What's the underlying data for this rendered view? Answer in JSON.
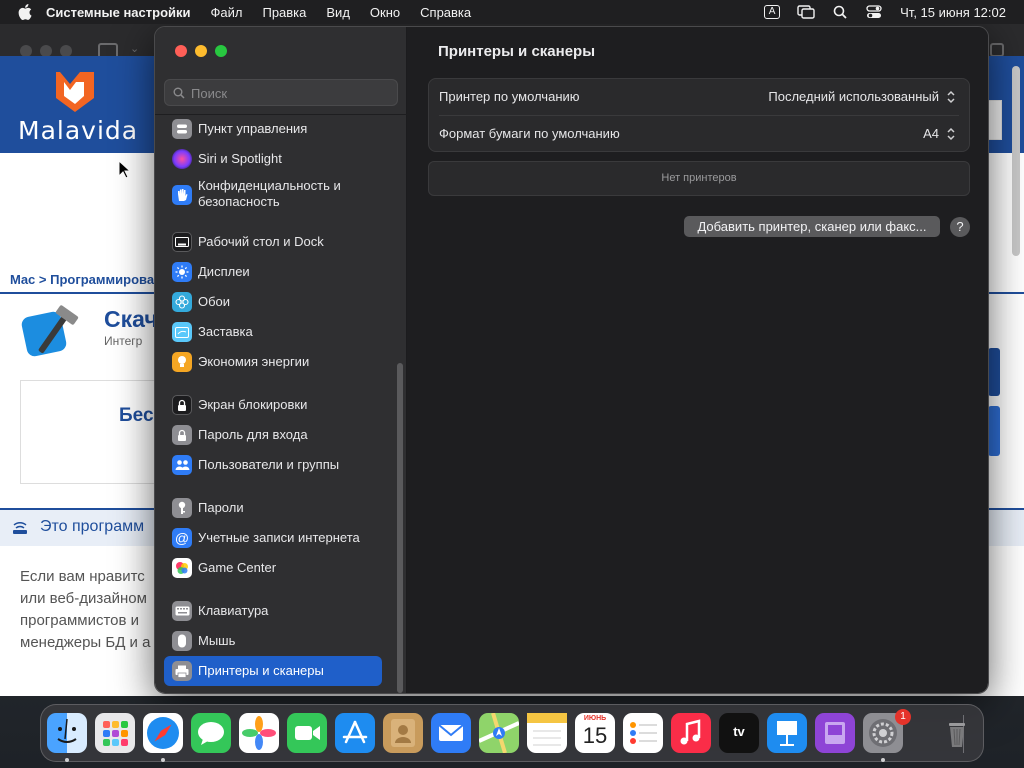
{
  "menubar": {
    "app_name": "Системные настройки",
    "items": [
      "Файл",
      "Правка",
      "Вид",
      "Окно",
      "Справка"
    ],
    "input_indicator": "A",
    "clock": "Чт, 15 июня  12:02"
  },
  "browser": {
    "site_logo": "Malavida",
    "breadcrumb": "Mac > Программирова",
    "app_title": "Скач",
    "app_subtitle": "Интегр",
    "download_text": "Бес",
    "section_title": "Это программ",
    "paragraph_lines": [
      "Если вам нравитс",
      "или веб-дизайном",
      "программистов и",
      "менеджеры БД и а"
    ]
  },
  "settings": {
    "search_placeholder": "Поиск",
    "sidebar": {
      "items": [
        {
          "label": "Пункт управления",
          "icon": "control-center-icon",
          "color": "#8e8e93"
        },
        {
          "label": "Siri и Spotlight",
          "icon": "siri-icon",
          "color": "#b14ad6"
        },
        {
          "label": "Конфиденциальность и",
          "label2": "безопасность",
          "icon": "privacy-hand-icon",
          "color": "#2f7cf6"
        },
        {
          "label": "Рабочий стол и Dock",
          "icon": "desktop-dock-icon",
          "color": "#1c1c1e"
        },
        {
          "label": "Дисплеи",
          "icon": "displays-sun-icon",
          "color": "#2f7cf6"
        },
        {
          "label": "Обои",
          "icon": "wallpaper-flower-icon",
          "color": "#34aadc"
        },
        {
          "label": "Заставка",
          "icon": "screensaver-icon",
          "color": "#5ac8fa"
        },
        {
          "label": "Экономия энергии",
          "icon": "energy-bulb-icon",
          "color": "#f5a623"
        },
        {
          "label": "Экран блокировки",
          "icon": "lock-screen-icon",
          "color": "#1c1c1e"
        },
        {
          "label": "Пароль для входа",
          "icon": "login-password-lock-icon",
          "color": "#8e8e93"
        },
        {
          "label": "Пользователи и группы",
          "icon": "users-groups-icon",
          "color": "#2f7cf6"
        },
        {
          "label": "Пароли",
          "icon": "passwords-key-icon",
          "color": "#8e8e93"
        },
        {
          "label": "Учетные записи интернета",
          "icon": "internet-accounts-at-icon",
          "color": "#2f7cf6"
        },
        {
          "label": "Game Center",
          "icon": "game-center-icon",
          "color": "#ffffff"
        },
        {
          "label": "Клавиатура",
          "icon": "keyboard-icon",
          "color": "#8e8e93"
        },
        {
          "label": "Мышь",
          "icon": "mouse-icon",
          "color": "#8e8e93"
        },
        {
          "label": "Принтеры и сканеры",
          "icon": "printer-icon",
          "color": "#8e8e93",
          "selected": true
        }
      ]
    },
    "main": {
      "title": "Принтеры и сканеры",
      "default_printer_label": "Принтер по умолчанию",
      "default_printer_value": "Последний использованный",
      "paper_size_label": "Формат бумаги по умолчанию",
      "paper_size_value": "A4",
      "no_printers": "Нет принтеров",
      "add_button": "Добавить принтер, сканер или факс...",
      "help_button": "?"
    }
  },
  "dock": {
    "apps": [
      "Finder",
      "Launchpad",
      "Safari",
      "Messages",
      "Photos",
      "FaceTime",
      "App Store",
      "Contacts",
      "Mail",
      "Maps",
      "Notes",
      "Calendar",
      "Reminders",
      "Music",
      "TV",
      "Keynote",
      "Podcasts",
      "System Settings",
      "Trash"
    ],
    "calendar_month": "ИЮНЬ",
    "calendar_day": "15",
    "tv_label": "tv",
    "settings_badge": "1"
  }
}
